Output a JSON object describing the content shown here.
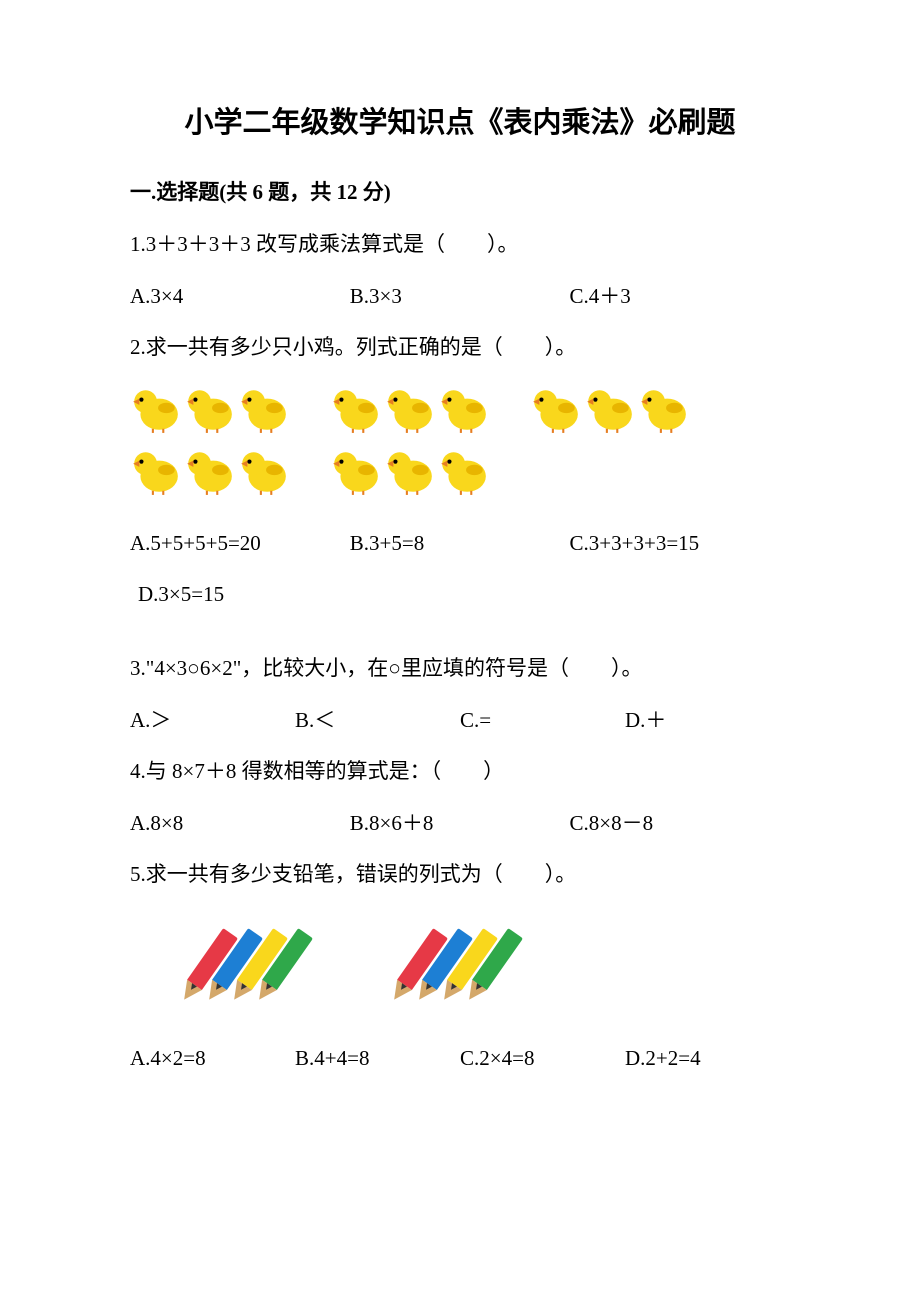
{
  "title": "小学二年级数学知识点《表内乘法》必刷题",
  "section1": {
    "header": "一.选择题(共 6 题，共 12 分)",
    "q1": {
      "text": "1.3＋3＋3＋3 改写成乘法算式是（　　）。",
      "optA": "A.3×4",
      "optB": "B.3×3",
      "optC": "C.4＋3"
    },
    "q2": {
      "text": "2.求一共有多少只小鸡。列式正确的是（　　）。",
      "optA": "A.5+5+5+5=20",
      "optB": "B.3+5=8",
      "optC": "C.3+3+3+3=15",
      "optD": "D.3×5=15"
    },
    "q3": {
      "text": "3.\"4×3○6×2\"，比较大小，在○里应填的符号是（　　）。",
      "optA": "A.＞",
      "optB": "B.＜",
      "optC": "C.=",
      "optD": "D.＋"
    },
    "q4": {
      "text": "4.与 8×7＋8 得数相等的算式是：（　　）",
      "optA": "A.8×8",
      "optB": "B.8×6＋8",
      "optC": "C.8×8－8"
    },
    "q5": {
      "text": "5.求一共有多少支铅笔，错误的列式为（　　）。",
      "optA": "A.4×2=8",
      "optB": "B.4+4=8",
      "optC": "C.2×4=8",
      "optD": "D.2+2=4"
    }
  },
  "icons": {
    "chick": "chick-illustration",
    "pencil": "pencil-illustration"
  }
}
